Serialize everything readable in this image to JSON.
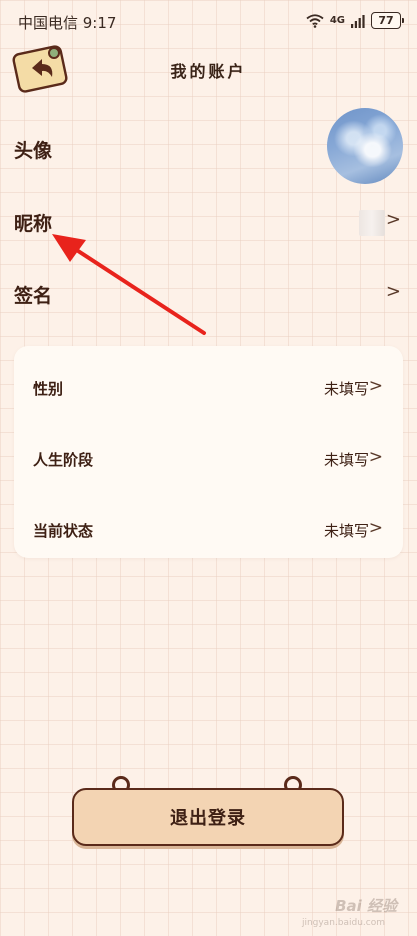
{
  "status_bar": {
    "carrier": "中国电信 9:17",
    "network": "4G",
    "battery": "77"
  },
  "header": {
    "title": "我的账户",
    "back_icon": "back-arrow-icon"
  },
  "profile_rows": [
    {
      "label": "头像"
    },
    {
      "label": "昵称"
    },
    {
      "label": "签名"
    }
  ],
  "card_rows": [
    {
      "label": "性别",
      "value": "未填写"
    },
    {
      "label": "人生阶段",
      "value": "未填写"
    },
    {
      "label": "当前状态",
      "value": "未填写"
    }
  ],
  "chevron": ">",
  "logout": {
    "label": "退出登录"
  },
  "watermark": {
    "text": "Bai 经验",
    "sub": "jingyan.baidu.com"
  },
  "colors": {
    "accent": "#f3d4b3",
    "text": "#3e2014",
    "annotation": "#e8231c"
  }
}
